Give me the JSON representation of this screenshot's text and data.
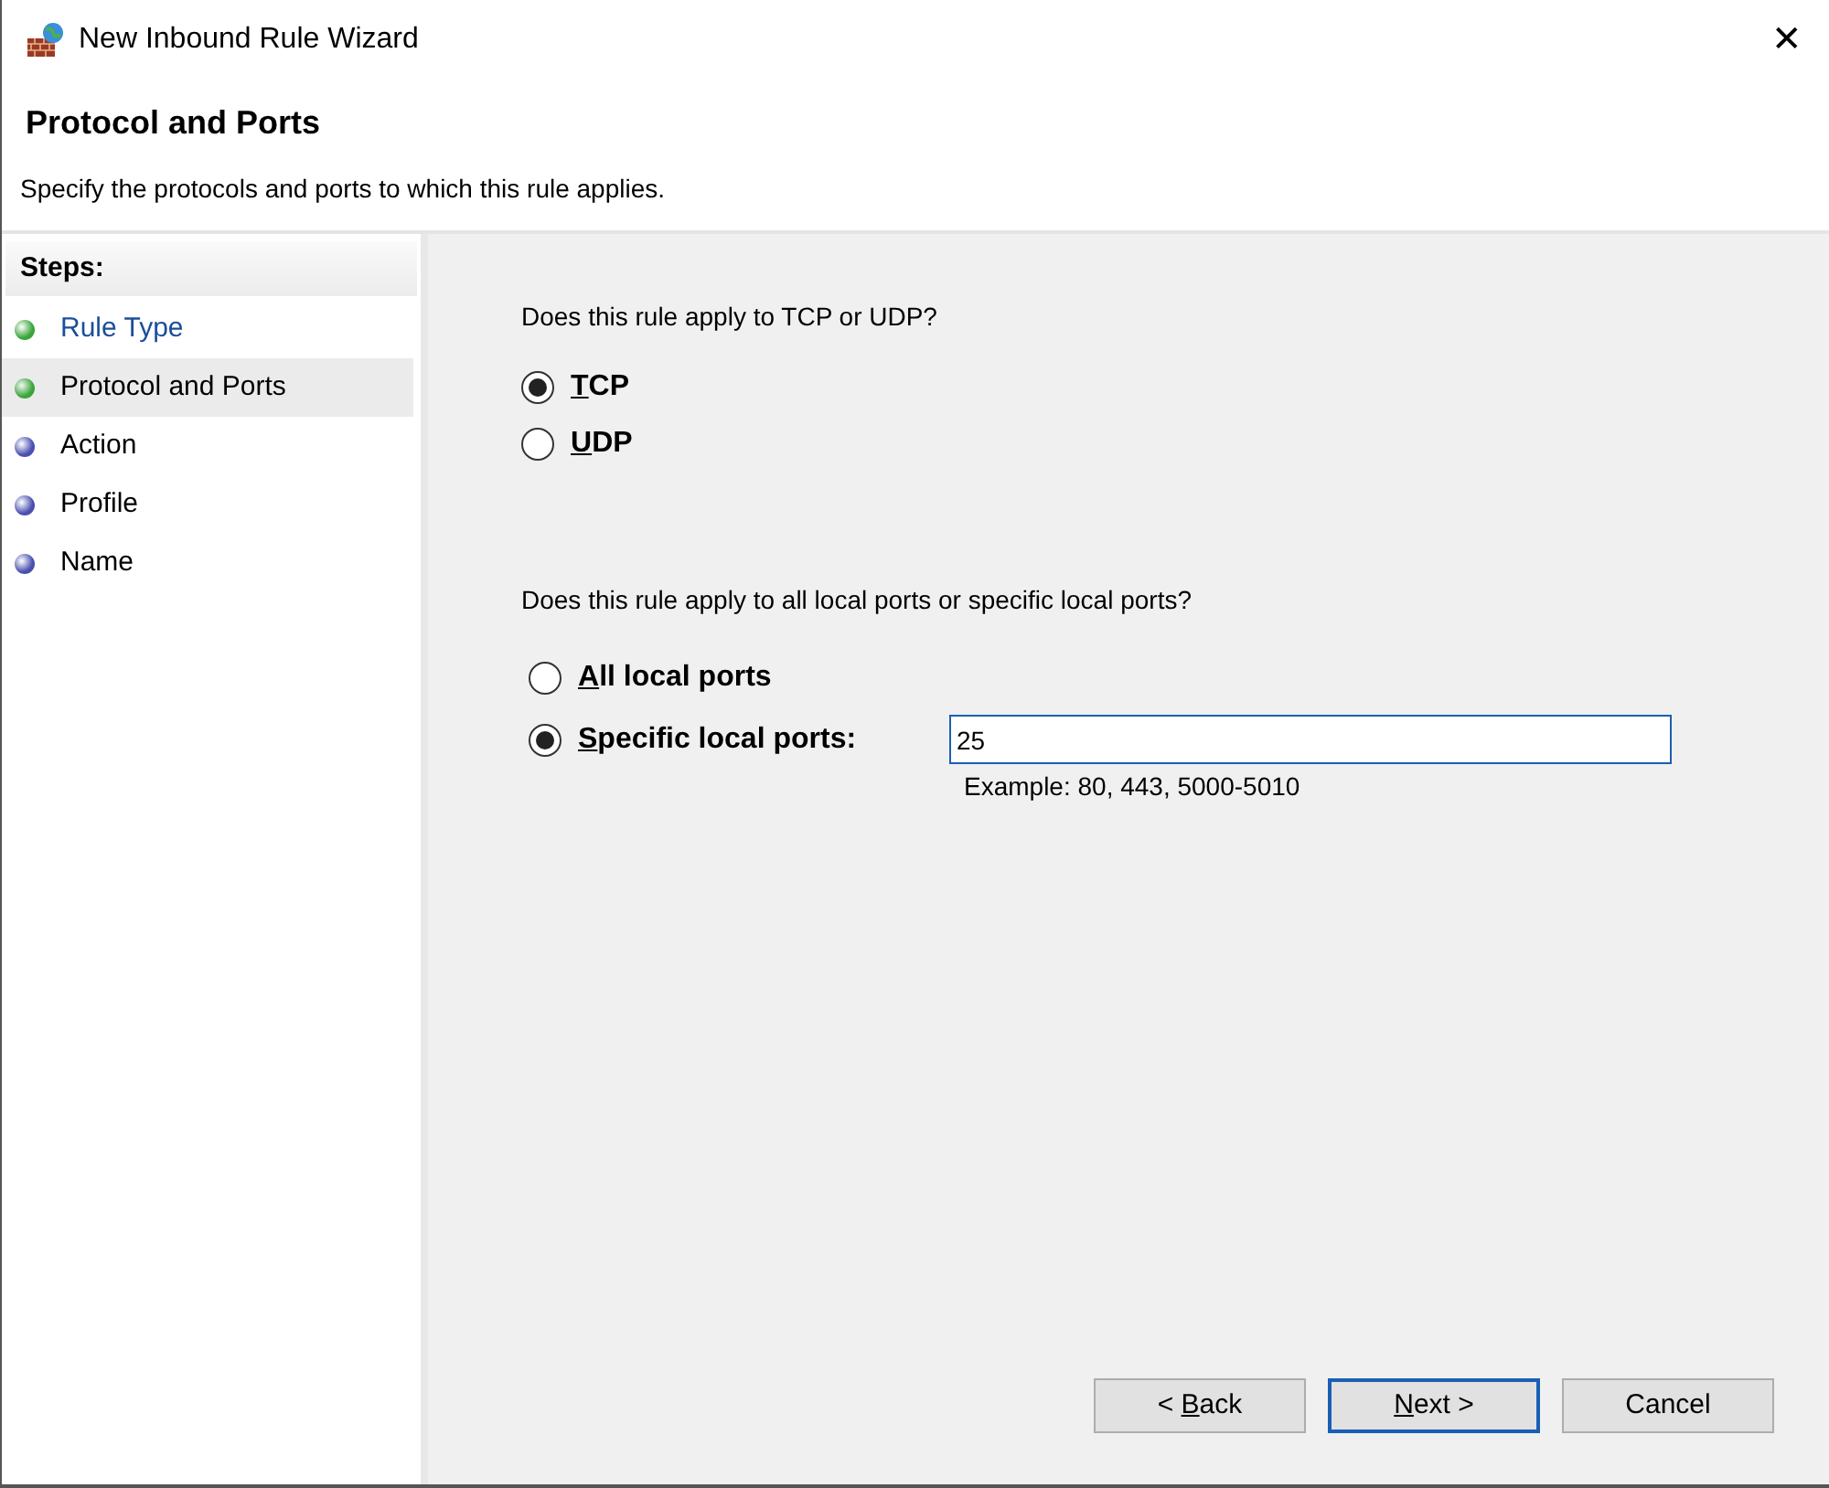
{
  "window": {
    "title": "New Inbound Rule Wizard",
    "close": "✕"
  },
  "header": {
    "title": "Protocol and Ports",
    "subtitle": "Specify the protocols and ports to which this rule applies."
  },
  "steps": {
    "heading": "Steps:",
    "items": [
      {
        "label": "Rule Type",
        "complete": true,
        "selected": false
      },
      {
        "label": "Protocol and Ports",
        "complete": true,
        "selected": true
      },
      {
        "label": "Action",
        "complete": false,
        "selected": false
      },
      {
        "label": "Profile",
        "complete": false,
        "selected": false
      },
      {
        "label": "Name",
        "complete": false,
        "selected": false
      }
    ]
  },
  "protocol": {
    "question": "Does this rule apply to TCP or UDP?",
    "options": [
      {
        "label": "TCP",
        "access_key": true,
        "selected": true
      },
      {
        "label": "UDP",
        "access_key": true,
        "selected": false
      }
    ]
  },
  "ports": {
    "question": "Does this rule apply to all local ports or specific local ports?",
    "options": [
      {
        "label": "All local ports",
        "access_key": true,
        "selected": false
      },
      {
        "label": "Specific local ports:",
        "access_key": true,
        "selected": true
      }
    ],
    "value": "25",
    "example": "Example: 80, 443, 5000-5010"
  },
  "buttons": [
    {
      "label": "< Back",
      "access_key": true,
      "default": false
    },
    {
      "label": "Next >",
      "access_key": true,
      "default": true
    },
    {
      "label": "Cancel",
      "access_key": false,
      "default": false
    }
  ]
}
